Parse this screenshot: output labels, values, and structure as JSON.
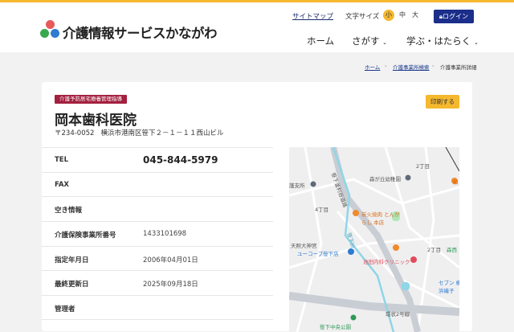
{
  "header": {
    "site_title": "介護情報サービスかながわ",
    "sitemap": "サイトマップ",
    "font_size_label": "文字サイズ",
    "font_sizes": [
      "小",
      "中",
      "大"
    ],
    "font_size_selected": "小",
    "login": "ログイン",
    "nav": [
      "ホーム",
      "さがす",
      "学ぶ・はたらく"
    ]
  },
  "breadcrumb": [
    "ホーム",
    "介護事業所検索",
    "介護事業所詳細"
  ],
  "facility": {
    "service_badge": "介護予防居宅療養管理指導",
    "print_button": "印刷する",
    "name": "岡本歯科医院",
    "postal": "〒234-0052",
    "address": "横浜市港南区笹下２－１－１１西山ビル",
    "rows": [
      {
        "label": "TEL",
        "value": "045-844-5979"
      },
      {
        "label": "FAX",
        "value": ""
      },
      {
        "label": "空き情報",
        "value": ""
      },
      {
        "label": "介護保険事業所番号",
        "value": "1433101698"
      },
      {
        "label": "指定年月日",
        "value": "2006年04月01日"
      },
      {
        "label": "最終更新日",
        "value": "2025年09月18日"
      },
      {
        "label": "管理者",
        "value": ""
      }
    ]
  },
  "map": {
    "labels": [
      "2丁目",
      "森が丘幼稚園",
      "笹下釜利谷道路",
      "護支所",
      "4丁目",
      "炭火焼肉 とんがらし 本店",
      "天照大神宮",
      "ユーコープ笹下店",
      "池田内科クリニック",
      "2丁目",
      "森西",
      "セブン 横浜磯子",
      "環状2号線",
      "笹下中央公園",
      "笹下川",
      "和"
    ]
  },
  "colors": {
    "accent": "#f5b82e",
    "login": "#1a2e8a",
    "badge": "#a3203f"
  }
}
